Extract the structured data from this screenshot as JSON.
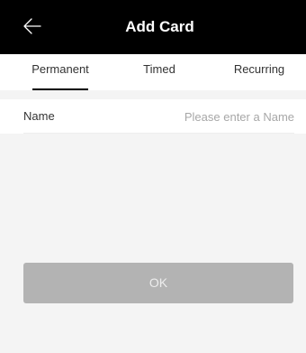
{
  "header": {
    "title": "Add Card",
    "back_icon": "arrow-left-icon",
    "background": "#000000"
  },
  "tabs": [
    {
      "label": "Permanent",
      "active": true
    },
    {
      "label": "Timed",
      "active": false
    },
    {
      "label": "Recurring",
      "active": false
    }
  ],
  "form": {
    "name_label": "Name",
    "name_value": "",
    "name_placeholder": "Please enter a Name"
  },
  "actions": {
    "ok_label": "OK",
    "ok_disabled": true
  }
}
